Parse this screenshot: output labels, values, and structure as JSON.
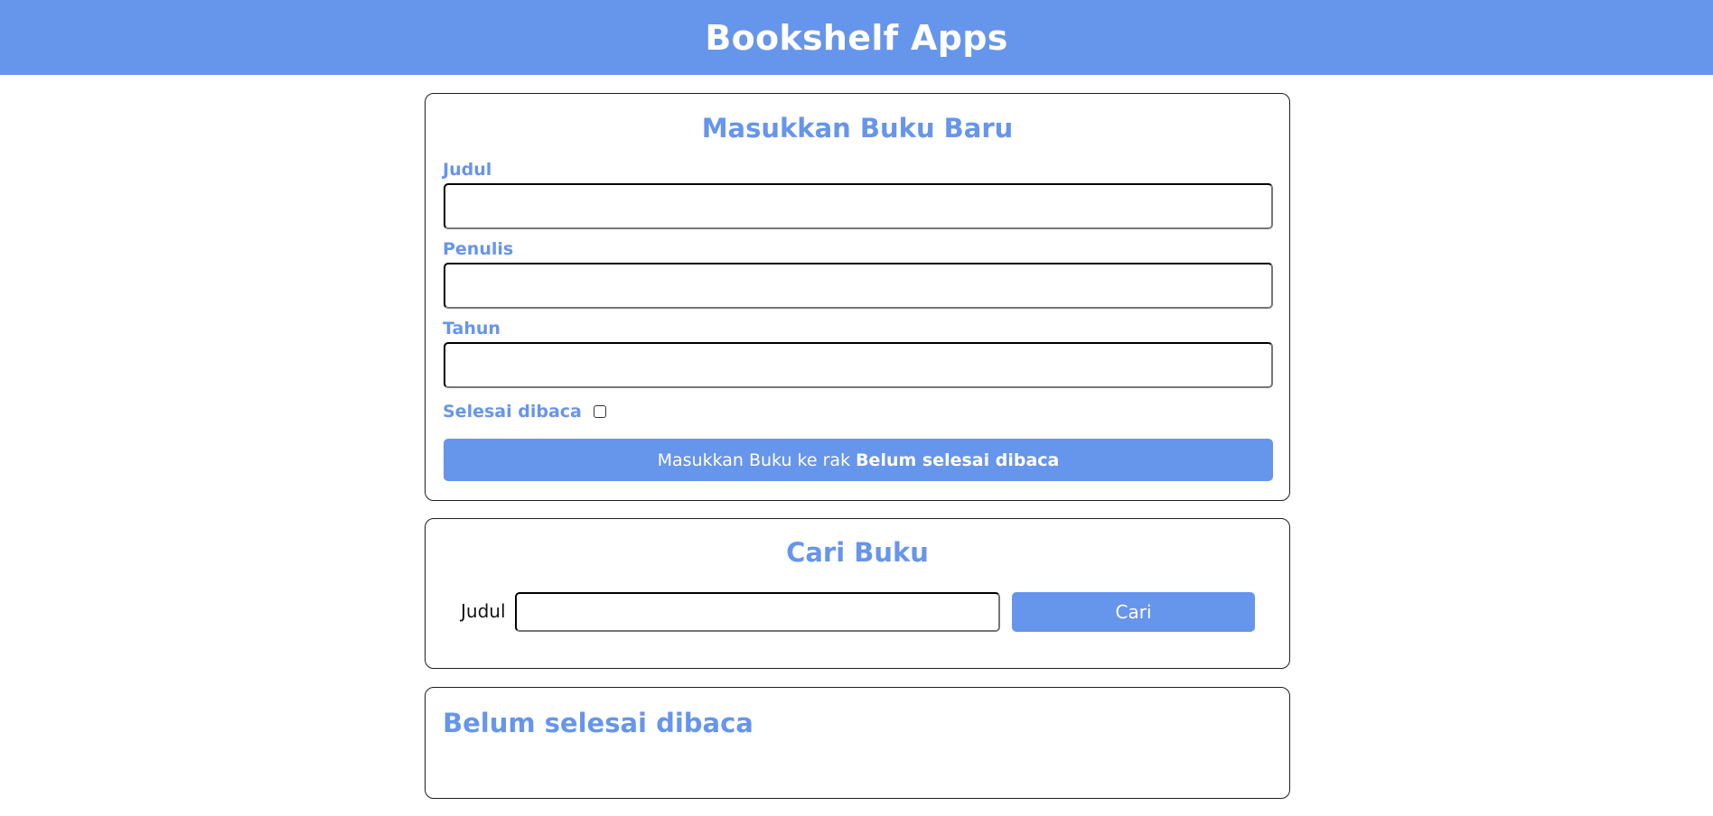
{
  "header": {
    "title": "Bookshelf Apps"
  },
  "input_section": {
    "heading": "Masukkan Buku Baru",
    "fields": [
      {
        "label": "Judul",
        "value": ""
      },
      {
        "label": "Penulis",
        "value": ""
      },
      {
        "label": "Tahun",
        "value": ""
      }
    ],
    "complete_checkbox": {
      "label": "Selesai dibaca",
      "checked": false
    },
    "submit_button": {
      "prefix": "Masukkan Buku ke rak",
      "shelf": "Belum selesai dibaca"
    }
  },
  "search_section": {
    "heading": "Cari Buku",
    "label": "Judul",
    "value": "",
    "button_label": "Cari"
  },
  "incomplete_section": {
    "heading": "Belum selesai dibaca"
  },
  "colors": {
    "accent": "#6695EC",
    "text_on_accent": "#FFFFFF"
  }
}
